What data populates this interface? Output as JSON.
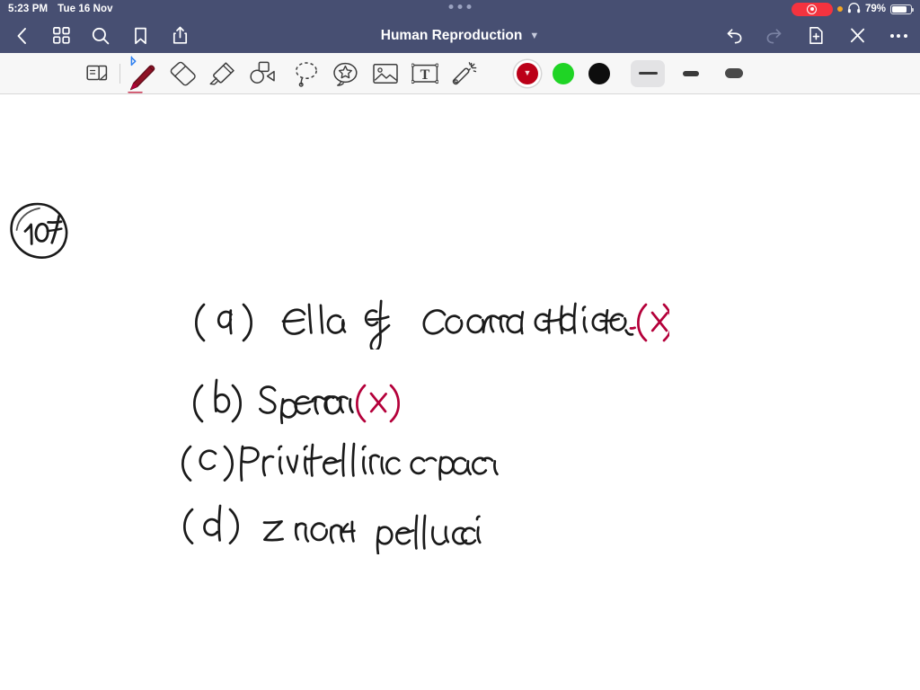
{
  "status_bar": {
    "time": "5:23 PM",
    "date": "Tue 16 Nov",
    "recording_icon": "record-target-icon",
    "privacy_dot_icon": "orange-privacy-dot-icon",
    "headphones_icon": "headphones-icon",
    "battery_percent": "79%",
    "battery_level": 79,
    "grabber_icon": "multitask-grabber-icon"
  },
  "nav_bar": {
    "title": "Human Reproduction",
    "title_chevron_icon": "chevron-down-icon",
    "left_buttons": [
      {
        "name": "back-button",
        "icon": "chevron-left-icon"
      },
      {
        "name": "thumbnails-button",
        "icon": "grid-squares-icon"
      },
      {
        "name": "search-button",
        "icon": "search-icon"
      },
      {
        "name": "bookmark-button",
        "icon": "bookmark-icon"
      },
      {
        "name": "share-button",
        "icon": "share-upload-icon"
      }
    ],
    "right_buttons": [
      {
        "name": "undo-button",
        "icon": "undo-arrow-icon",
        "enabled": true
      },
      {
        "name": "redo-button",
        "icon": "redo-arrow-icon",
        "enabled": false
      },
      {
        "name": "add-page-button",
        "icon": "document-plus-icon",
        "enabled": true
      },
      {
        "name": "close-button",
        "icon": "close-x-icon",
        "enabled": true
      },
      {
        "name": "more-options-button",
        "icon": "ellipsis-icon",
        "enabled": true
      }
    ]
  },
  "toolbar": {
    "tools": [
      {
        "name": "page-layout-tool",
        "icon": "page-flip-icon",
        "selected": false
      },
      {
        "name": "pen-tool",
        "icon": "pen-icon",
        "selected": true,
        "badge_icon": "bluetooth-icon"
      },
      {
        "name": "eraser-tool",
        "icon": "eraser-icon",
        "selected": false
      },
      {
        "name": "highlighter-tool",
        "icon": "highlighter-icon",
        "selected": false
      },
      {
        "name": "shapes-tool",
        "icon": "shapes-icon",
        "selected": false
      },
      {
        "name": "lasso-tool",
        "icon": "lasso-dashed-icon",
        "selected": false
      },
      {
        "name": "sticker-tool",
        "icon": "sticker-star-icon",
        "selected": false
      },
      {
        "name": "image-tool",
        "icon": "photo-icon",
        "selected": false
      },
      {
        "name": "text-tool",
        "icon": "text-box-icon",
        "selected": false
      },
      {
        "name": "magic-wand-tool",
        "icon": "magic-wand-icon",
        "selected": false
      }
    ],
    "colors": [
      {
        "name": "color-swatch-red",
        "hex": "#bb0018",
        "selected": true,
        "chevron_icon": "chevron-down-icon"
      },
      {
        "name": "color-swatch-green",
        "hex": "#1fd425",
        "selected": false
      },
      {
        "name": "color-swatch-black",
        "hex": "#0d0d0d",
        "selected": false
      }
    ],
    "stroke_widths": [
      {
        "name": "stroke-width-thin",
        "label": "thin",
        "selected": true
      },
      {
        "name": "stroke-width-medium",
        "label": "medium",
        "selected": false
      },
      {
        "name": "stroke-width-thick",
        "label": "thick",
        "selected": false
      }
    ]
  },
  "canvas": {
    "page_number": "107",
    "ink_color_black": "#1a1a1a",
    "ink_color_red": "#b4003a",
    "notes": [
      {
        "name": "answer-line-a",
        "text": "(a) Cells of corona radiata",
        "mark": "(x)",
        "mark_color": "#b4003a"
      },
      {
        "name": "answer-line-b",
        "text": "(b) Sperm",
        "mark": "(x)",
        "mark_color": "#b4003a"
      },
      {
        "name": "answer-line-c",
        "text": "(c) Perivitelline space",
        "mark": "",
        "mark_color": ""
      },
      {
        "name": "answer-line-d",
        "text": "(d) Zona pellucida",
        "mark": "",
        "mark_color": ""
      }
    ]
  }
}
